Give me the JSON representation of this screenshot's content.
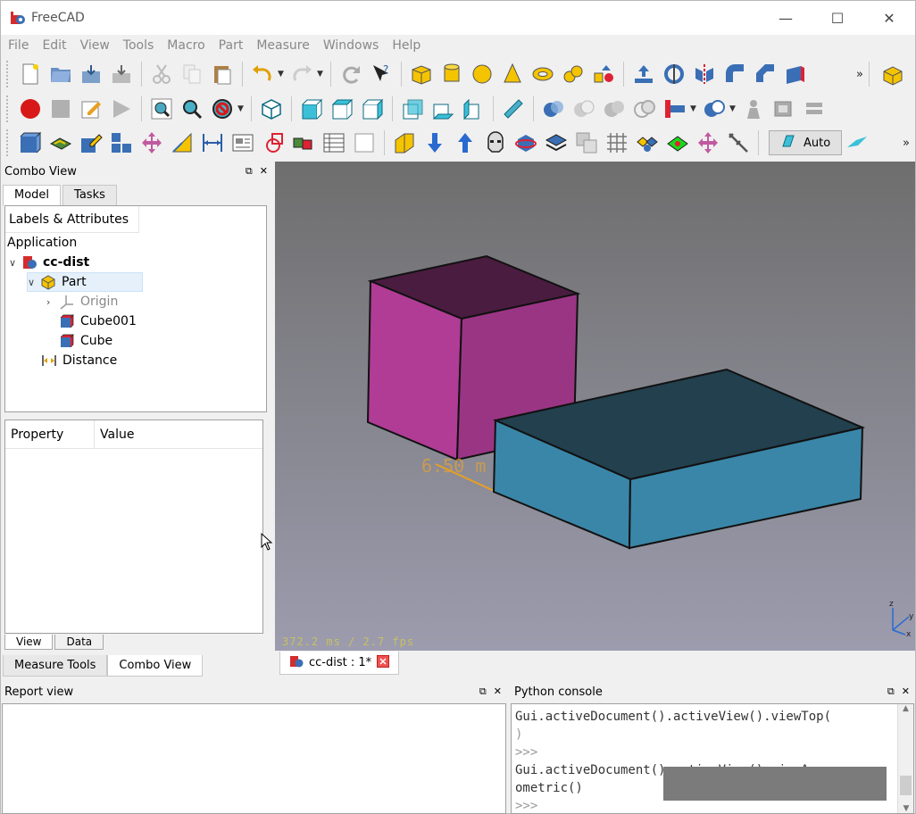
{
  "window": {
    "title": "FreeCAD",
    "icon": "freecad-icon"
  },
  "menu": [
    "File",
    "Edit",
    "View",
    "Tools",
    "Macro",
    "Part",
    "Measure",
    "Windows",
    "Help"
  ],
  "toolbar": {
    "auto_label": "Auto",
    "more": "»"
  },
  "combo": {
    "title": "Combo View",
    "tabs": [
      "Model",
      "Tasks"
    ],
    "tree_header": "Labels & Attributes",
    "tree": {
      "root": "Application",
      "document": "cc-dist",
      "part": "Part",
      "origin": "Origin",
      "cube001": "Cube001",
      "cube": "Cube",
      "distance": "Distance"
    },
    "property_cols": [
      "Property",
      "Value"
    ],
    "view_data_tabs": [
      "View",
      "Data"
    ],
    "bottom_tabs": [
      "Measure Tools",
      "Combo View"
    ]
  },
  "view3d": {
    "fps": "372.2 ms / 2.7 fps",
    "dimension_label": "6.50 m",
    "document_tab": "cc-dist : 1*",
    "colors": {
      "cube_front": "#9a3584",
      "cube_top": "#4a1c40",
      "box_front": "#3a86a8",
      "box_top": "#22404e"
    }
  },
  "report": {
    "title": "Report view"
  },
  "python": {
    "title": "Python console",
    "lines": [
      "Gui.activeDocument().activeView().viewTop(",
      ")",
      ">>>",
      "Gui.activeDocument().activeView().viewAxon",
      "ometric()",
      ">>>"
    ]
  }
}
